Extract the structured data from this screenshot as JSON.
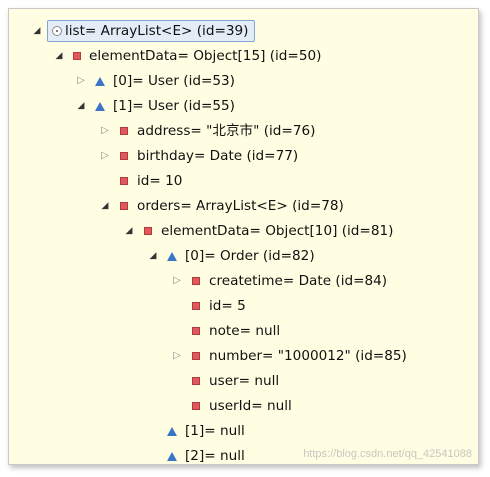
{
  "tree": {
    "rows": [
      {
        "label": "list= ArrayList<E>  (id=39)",
        "toggle": "◢",
        "icon": "circle"
      },
      {
        "label": "elementData= Object[15]  (id=50)",
        "toggle": "◢",
        "icon": "square"
      },
      {
        "label": "[0]= User  (id=53)",
        "toggle": "▷",
        "icon": "triangle"
      },
      {
        "label": "[1]= User  (id=55)",
        "toggle": "◢",
        "icon": "triangle"
      },
      {
        "label": "address= \"北京市\" (id=76)",
        "toggle": "▷",
        "icon": "square"
      },
      {
        "label": "birthday= Date  (id=77)",
        "toggle": "▷",
        "icon": "square"
      },
      {
        "label": "id= 10",
        "toggle": "",
        "icon": "square"
      },
      {
        "label": "orders= ArrayList<E>  (id=78)",
        "toggle": "◢",
        "icon": "square"
      },
      {
        "label": "elementData= Object[10]  (id=81)",
        "toggle": "◢",
        "icon": "square"
      },
      {
        "label": "[0]= Order  (id=82)",
        "toggle": "◢",
        "icon": "triangle"
      },
      {
        "label": "createtime= Date  (id=84)",
        "toggle": "▷",
        "icon": "square"
      },
      {
        "label": "id= 5",
        "toggle": "",
        "icon": "square"
      },
      {
        "label": "note= null",
        "toggle": "",
        "icon": "square"
      },
      {
        "label": "number= \"1000012\" (id=85)",
        "toggle": "▷",
        "icon": "square"
      },
      {
        "label": "user= null",
        "toggle": "",
        "icon": "square"
      },
      {
        "label": "userId= null",
        "toggle": "",
        "icon": "square"
      },
      {
        "label": "[1]= null",
        "toggle": "",
        "icon": "triangle"
      },
      {
        "label": "[2]= null",
        "toggle": "",
        "icon": "triangle"
      }
    ]
  },
  "watermark": "https://blog.csdn.net/qq_42541088",
  "colors": {
    "background": "#fffee3",
    "field_icon": "#e0575c",
    "element_icon": "#3c74c6",
    "selection": "#e4ecf7"
  }
}
